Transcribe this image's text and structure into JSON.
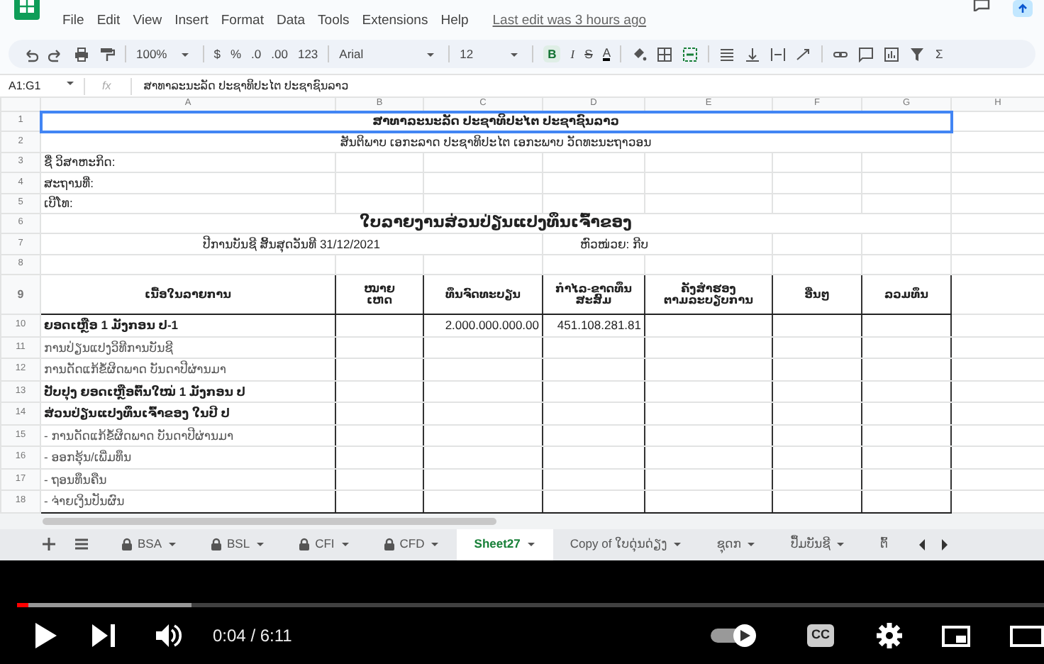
{
  "menu": [
    "File",
    "Edit",
    "View",
    "Insert",
    "Format",
    "Data",
    "Tools",
    "Extensions",
    "Help"
  ],
  "last_edit": "Last edit was 3 hours ago",
  "toolbar": {
    "zoom": "100%",
    "currency": "$",
    "percent": "%",
    "decrease_decimals": ".0",
    "increase_decimals": ".00",
    "more_formats": "123",
    "font": "Arial",
    "font_size": "12",
    "bold": {
      "label": "B",
      "on": true
    },
    "italic": "I",
    "strikethrough": "S",
    "text_color": "A",
    "functions": "Σ"
  },
  "formula_bar": {
    "name_box": "A1:G1",
    "fx_label": "fx",
    "content": "ສາທາລະນະລັດ ປະຊາທິປະໄຕ ປະຊາຊົນລາວ"
  },
  "column_headers": [
    "A",
    "B",
    "C",
    "D",
    "E",
    "F",
    "G",
    "H"
  ],
  "rows": [
    {
      "number": "1",
      "kind": "banner",
      "text": "ສາທາລະນະລັດ ປະຊາທິປະໄຕ ປະຊາຊົນລາວ",
      "selected": true
    },
    {
      "number": "2",
      "kind": "motto",
      "text": "ສັນຕິພາບ ເອກະລາດ ປະຊາທິປະໄຕ ເອກະພາບ ວັດທະນະຖາວອນ"
    },
    {
      "number": "3",
      "kind": "field",
      "text": "ຊື່ ວິສາຫະກິດ:"
    },
    {
      "number": "4",
      "kind": "field",
      "text": "ສະຖານທີ່:"
    },
    {
      "number": "5",
      "kind": "field",
      "text": "ເບີໂທ:"
    },
    {
      "number": "6",
      "kind": "heading",
      "text": "ໃບລາຍງານສ່ວນປ່ຽນແປງທຶນເຈົ້າຂອງ"
    },
    {
      "number": "7",
      "kind": "period",
      "text": "ປີການບັນຊີ ສິ້ນສຸດວັນທີ 31/12/2021",
      "unit": "ຫົວໜ່ວຍ: ກີບ"
    },
    {
      "number": "8",
      "kind": "blank"
    },
    {
      "number": "9",
      "kind": "table_header",
      "columns": [
        "ເນື້ອໃນລາຍການ",
        "ໝາຍ\nເຫດ",
        "ທຶນຈົດທະບຽນ",
        "ກຳໄລ-ຂາດທຶນ\nສະສົມ",
        "ຄັງສຳຮອງ\nຕາມລະບຽບການ",
        "ອື່ນໆ",
        "ລວມທຶນ"
      ]
    },
    {
      "number": "10",
      "kind": "section",
      "label": "ຍອດເຫຼືອ 1 ມັງກອນ ປ-1",
      "capital": "2.000.000.000.00",
      "retained": "451.108.281.81"
    },
    {
      "number": "11",
      "kind": "line",
      "label": "ການປ່ຽນແປງວິທີການບັນຊີ"
    },
    {
      "number": "12",
      "kind": "line",
      "label": "ການດັດແກ້ຂໍ້ຜິດພາດ ບັນດາປີຜ່ານມາ"
    },
    {
      "number": "13",
      "kind": "section",
      "label": "ປັບປຸງ ຍອດເຫຼືອຕົ້ນໃໝ່ 1 ມັງກອນ ປ"
    },
    {
      "number": "14",
      "kind": "section",
      "label": "ສ່ວນປ່ຽນແປງທຶນເຈົ້າຂອງ ໃນປີ ປ"
    },
    {
      "number": "15",
      "kind": "line",
      "label": " - ການດັດແກ້ຂໍ້ຜິດພາດ ບັນດາປີຜ່ານມາ"
    },
    {
      "number": "16",
      "kind": "line",
      "label": " - ອອກຮຸ້ນ/ເພີ່ມທຶນ"
    },
    {
      "number": "17",
      "kind": "line",
      "label": " - ຖອນທຶນຄືນ"
    },
    {
      "number": "18",
      "kind": "line",
      "label": " - ຈ່າຍເງິນປັນຜົນ"
    }
  ],
  "sheet_tabs": [
    {
      "label": "BSA",
      "locked": true,
      "selected": false
    },
    {
      "label": "BSL",
      "locked": true,
      "selected": false
    },
    {
      "label": "CFI",
      "locked": true,
      "selected": false
    },
    {
      "label": "CFD",
      "locked": true,
      "selected": false
    },
    {
      "label": "Sheet27",
      "locked": false,
      "selected": true
    },
    {
      "label": "Copy of ໃບດຸ່ນດ່ຽງ",
      "locked": false,
      "selected": false
    },
    {
      "label": "ຊຸດກ",
      "locked": false,
      "selected": false
    },
    {
      "label": "ປຶ້ມບັນຊີ",
      "locked": false,
      "selected": false
    },
    {
      "label": "ຕົ້",
      "locked": false,
      "selected": false
    }
  ],
  "player": {
    "progress": {
      "level": 0.011
    },
    "buffer": {
      "level": 0.17
    },
    "time": "0:04 / 6:11",
    "autoplay": {
      "on": true
    },
    "captions_label": "CC"
  }
}
